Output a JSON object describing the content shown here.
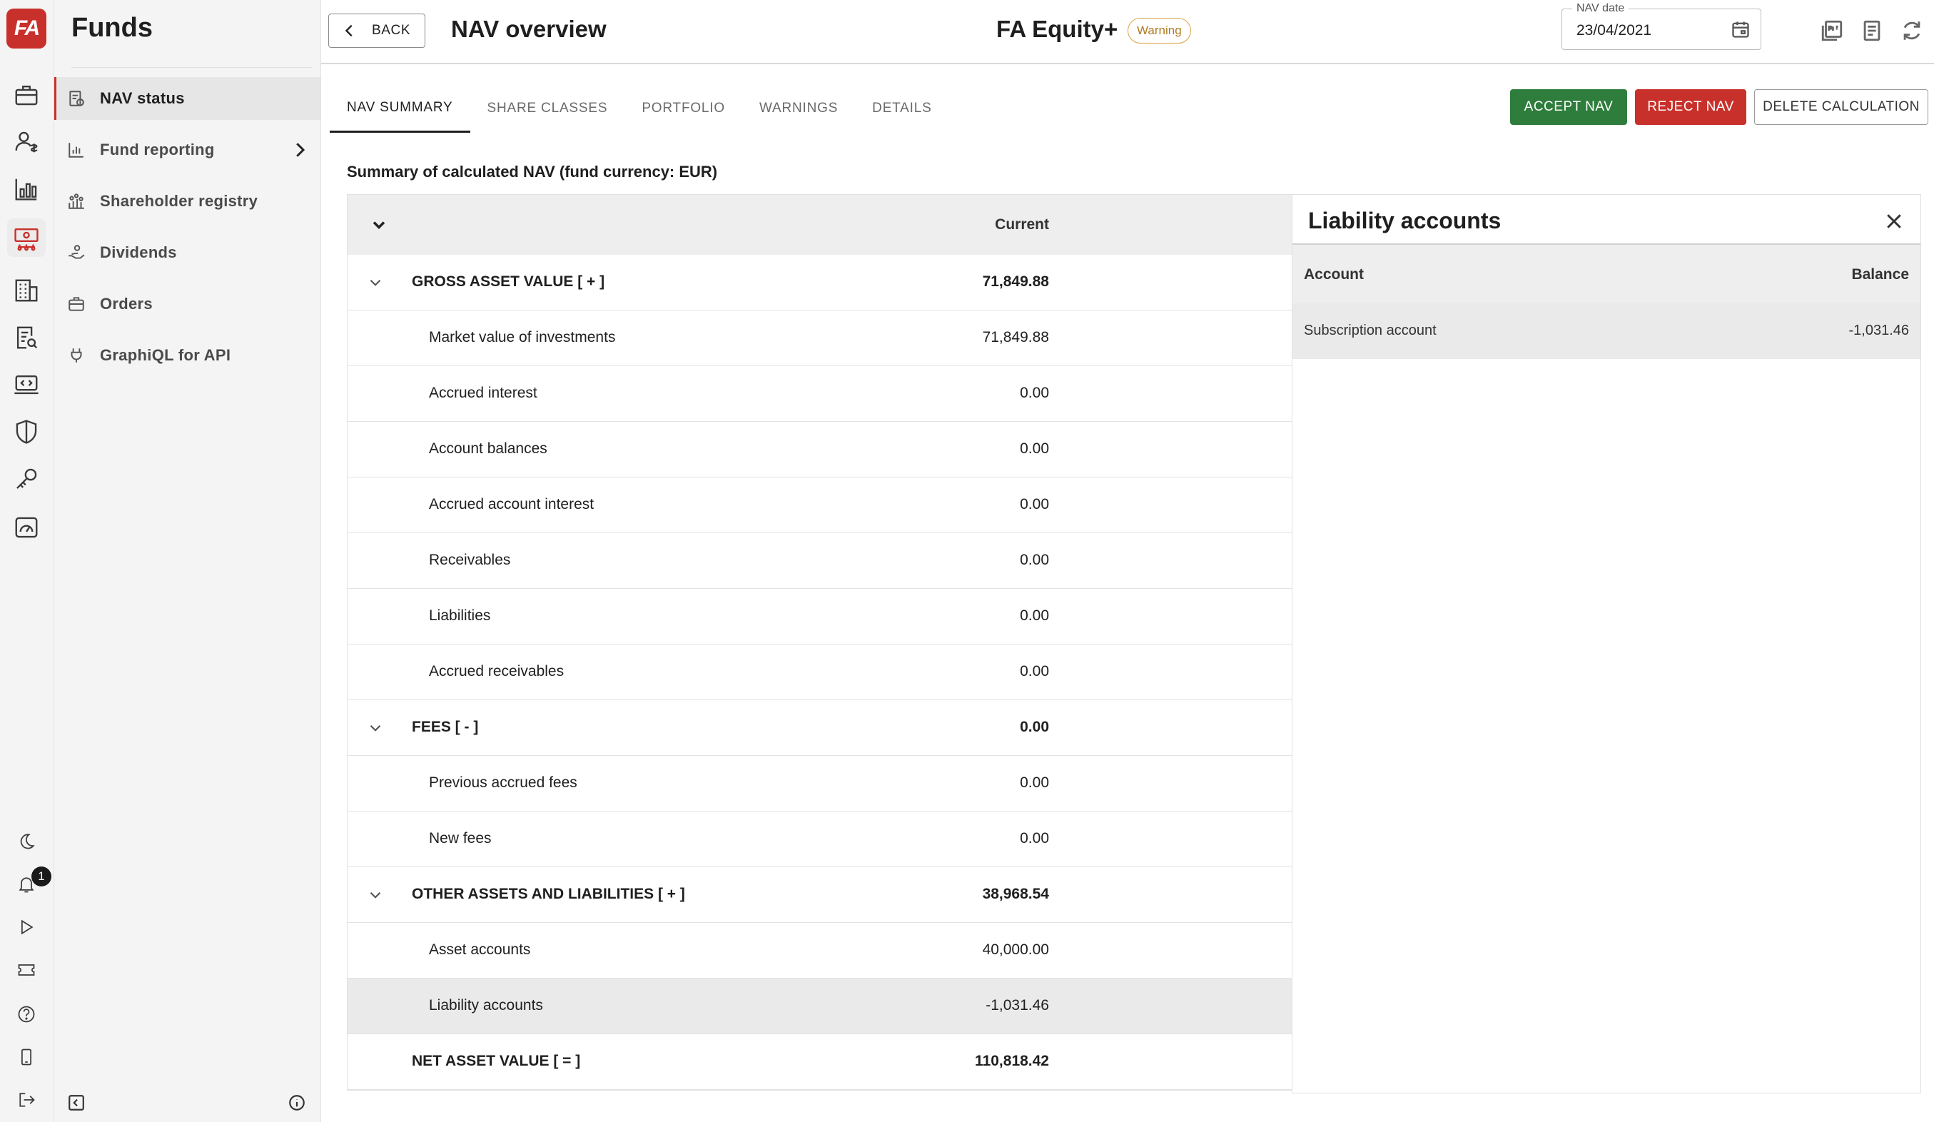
{
  "app": {
    "logo_text": "FA",
    "module_title": "Funds"
  },
  "sidebar": {
    "items": [
      {
        "label": "NAV status",
        "icon": "nav-status-icon",
        "active": true
      },
      {
        "label": "Fund reporting",
        "icon": "bar-chart-icon",
        "has_submenu": true
      },
      {
        "label": "Shareholder registry",
        "icon": "people-chart-icon"
      },
      {
        "label": "Dividends",
        "icon": "hand-coin-icon"
      },
      {
        "label": "Orders",
        "icon": "briefcase-icon"
      },
      {
        "label": "GraphiQL for API",
        "icon": "plug-icon"
      }
    ]
  },
  "rail": {
    "notifications_count": "1"
  },
  "header": {
    "back_label": "BACK",
    "page_title": "NAV overview",
    "fund_name": "FA Equity+",
    "status_badge": "Warning",
    "nav_date_label": "NAV date",
    "nav_date_value": "23/04/2021"
  },
  "tabs": [
    {
      "label": "NAV SUMMARY",
      "active": true
    },
    {
      "label": "SHARE CLASSES"
    },
    {
      "label": "PORTFOLIO"
    },
    {
      "label": "WARNINGS"
    },
    {
      "label": "DETAILS"
    }
  ],
  "actions": {
    "accept": "ACCEPT NAV",
    "reject": "REJECT NAV",
    "delete": "DELETE CALCULATION"
  },
  "summary": {
    "title": "Summary of calculated NAV (fund currency: EUR)",
    "column_header": "Current",
    "rows": [
      {
        "label": "GROSS ASSET VALUE [ + ]",
        "value": "71,849.88",
        "group": true,
        "expandable": true
      },
      {
        "label": "Market value of investments",
        "value": "71,849.88"
      },
      {
        "label": "Accrued interest",
        "value": "0.00"
      },
      {
        "label": "Account balances",
        "value": "0.00"
      },
      {
        "label": "Accrued account interest",
        "value": "0.00"
      },
      {
        "label": "Receivables",
        "value": "0.00"
      },
      {
        "label": "Liabilities",
        "value": "0.00"
      },
      {
        "label": "Accrued receivables",
        "value": "0.00"
      },
      {
        "label": "FEES [ - ]",
        "value": "0.00",
        "group": true,
        "expandable": true
      },
      {
        "label": "Previous accrued fees",
        "value": "0.00"
      },
      {
        "label": "New fees",
        "value": "0.00"
      },
      {
        "label": "OTHER ASSETS AND LIABILITIES [ + ]",
        "value": "38,968.54",
        "group": true,
        "expandable": true
      },
      {
        "label": "Asset accounts",
        "value": "40,000.00"
      },
      {
        "label": "Liability accounts",
        "value": "-1,031.46",
        "selected": true
      },
      {
        "label": "NET ASSET VALUE [ = ]",
        "value": "110,818.42",
        "group": true
      }
    ]
  },
  "liability_panel": {
    "title": "Liability accounts",
    "col_account": "Account",
    "col_balance": "Balance",
    "rows": [
      {
        "account": "Subscription account",
        "balance": "-1,031.46"
      }
    ]
  },
  "colors": {
    "brand_red": "#c8312b",
    "accept_green": "#2e7d3c",
    "warning_amber": "#d9a24a"
  }
}
